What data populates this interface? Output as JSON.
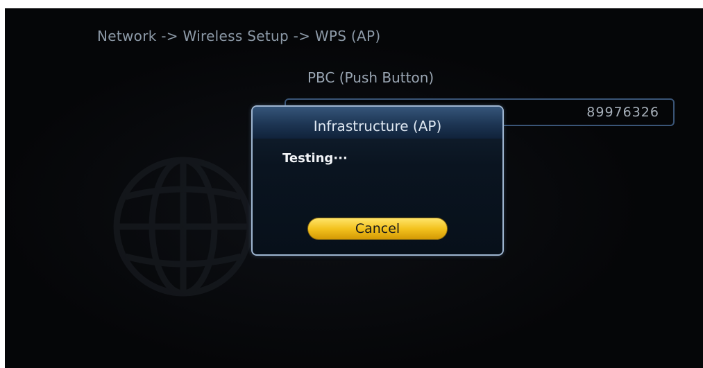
{
  "breadcrumb": "Network -> Wireless Setup -> WPS (AP)",
  "section_title": "PBC (Push Button)",
  "pin_field": {
    "value": "89976326"
  },
  "dialog": {
    "title": "Infrastructure (AP)",
    "status": "Testing···",
    "cancel_label": "Cancel"
  },
  "background_icon": "globe-icon",
  "colors": {
    "screen_bg": "#050608",
    "dialog_border": "#9fb6d1",
    "button_gold": "#f3c21e",
    "text_muted": "#8d9aa8"
  }
}
